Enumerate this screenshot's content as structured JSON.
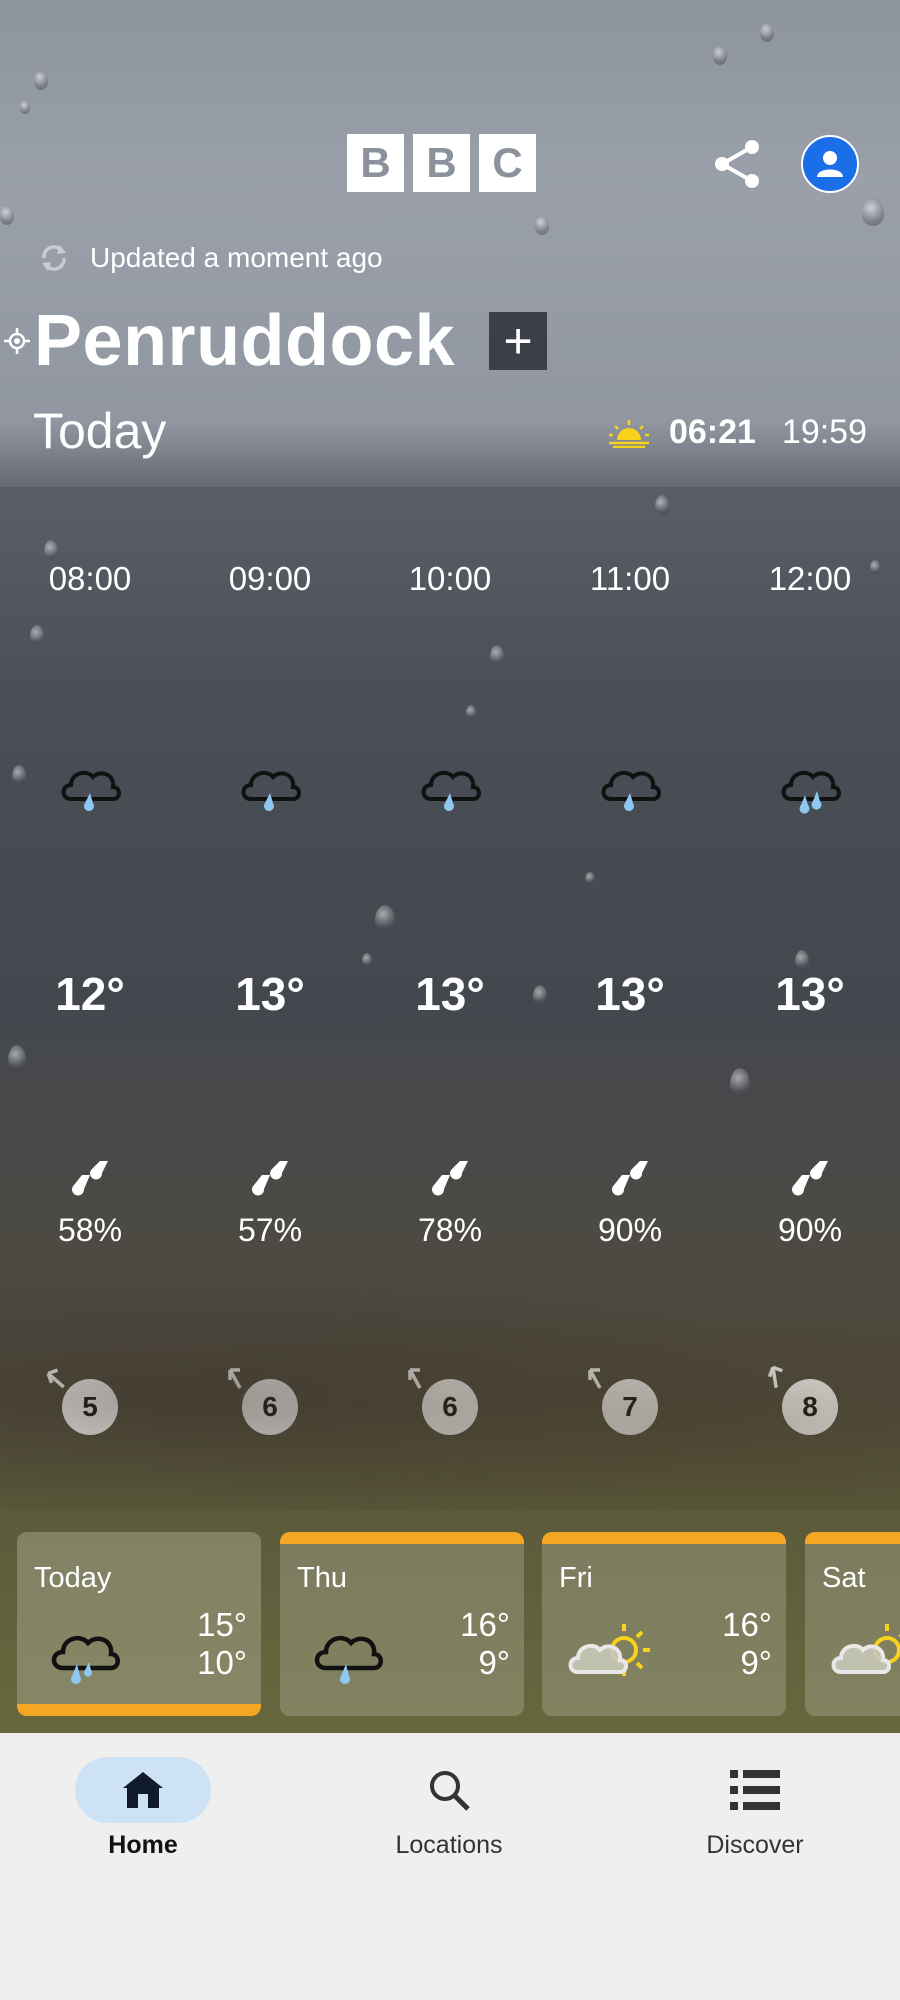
{
  "header": {
    "logo_letters": [
      "B",
      "B",
      "C"
    ],
    "updated_text": "Updated a moment ago",
    "location": "Penruddock",
    "add_label": "+",
    "day_label": "Today",
    "sunrise": "06:21",
    "sunset": "19:59"
  },
  "hourly": [
    {
      "time": "08:00",
      "icon": "cloud-light-rain-icon",
      "temp": "12°",
      "precip": "58%",
      "wind": "5"
    },
    {
      "time": "09:00",
      "icon": "cloud-light-rain-icon",
      "temp": "13°",
      "precip": "57%",
      "wind": "6"
    },
    {
      "time": "10:00",
      "icon": "cloud-light-rain-icon",
      "temp": "13°",
      "precip": "78%",
      "wind": "6"
    },
    {
      "time": "11:00",
      "icon": "cloud-light-rain-icon",
      "temp": "13°",
      "precip": "90%",
      "wind": "7"
    },
    {
      "time": "12:00",
      "icon": "cloud-heavy-rain-icon",
      "temp": "13°",
      "precip": "90%",
      "wind": "8"
    }
  ],
  "daily": [
    {
      "name": "Today",
      "icon": "cloud-light-rain-icon",
      "high": "15°",
      "low": "10°",
      "selected": true
    },
    {
      "name": "Thu",
      "icon": "cloud-light-rain-icon",
      "high": "16°",
      "low": "9°",
      "selected": false
    },
    {
      "name": "Fri",
      "icon": "sun-cloud-icon",
      "high": "16°",
      "low": "9°",
      "selected": false
    },
    {
      "name": "Sat",
      "icon": "sun-cloud-icon",
      "high": "",
      "low": "",
      "selected": false
    }
  ],
  "nav": {
    "home": "Home",
    "locations": "Locations",
    "discover": "Discover"
  },
  "colors": {
    "accent_blue": "#1a6fe8",
    "warning_orange": "#f5a623",
    "rain_blue": "#8ec8f0",
    "sun_yellow": "#f8d21c",
    "nav_active": "#cde3f5"
  }
}
